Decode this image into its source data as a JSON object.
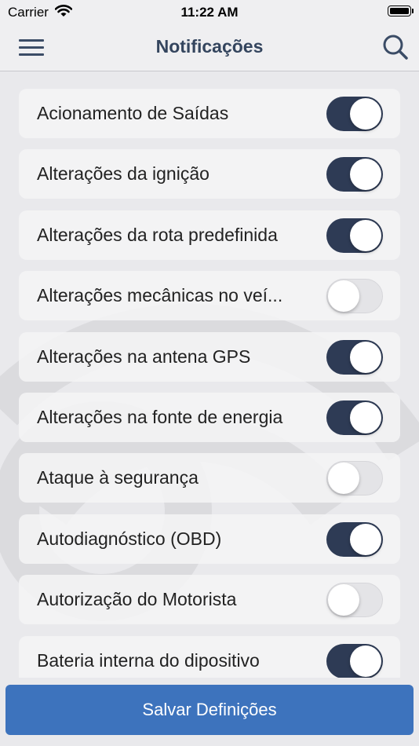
{
  "status_bar": {
    "carrier": "Carrier",
    "time": "11:22 AM"
  },
  "nav": {
    "title": "Notificações"
  },
  "notifications": [
    {
      "label": "Acionamento de Saídas",
      "enabled": true
    },
    {
      "label": "Alterações da ignição",
      "enabled": true
    },
    {
      "label": "Alterações da rota predefinida",
      "enabled": true
    },
    {
      "label": "Alterações mecânicas no veí...",
      "enabled": false
    },
    {
      "label": "Alterações na antena GPS",
      "enabled": true
    },
    {
      "label": "Alterações na fonte de energia",
      "enabled": true
    },
    {
      "label": "Ataque à segurança",
      "enabled": false
    },
    {
      "label": "Autodiagnóstico (OBD)",
      "enabled": true
    },
    {
      "label": "Autorização do Motorista",
      "enabled": false
    },
    {
      "label": "Bateria interna do dipositivo",
      "enabled": true
    }
  ],
  "footer": {
    "save_label": "Salvar Definições"
  },
  "colors": {
    "accent": "#3d73bd",
    "toggle_on": "#2e3b55",
    "title": "#34455e"
  }
}
